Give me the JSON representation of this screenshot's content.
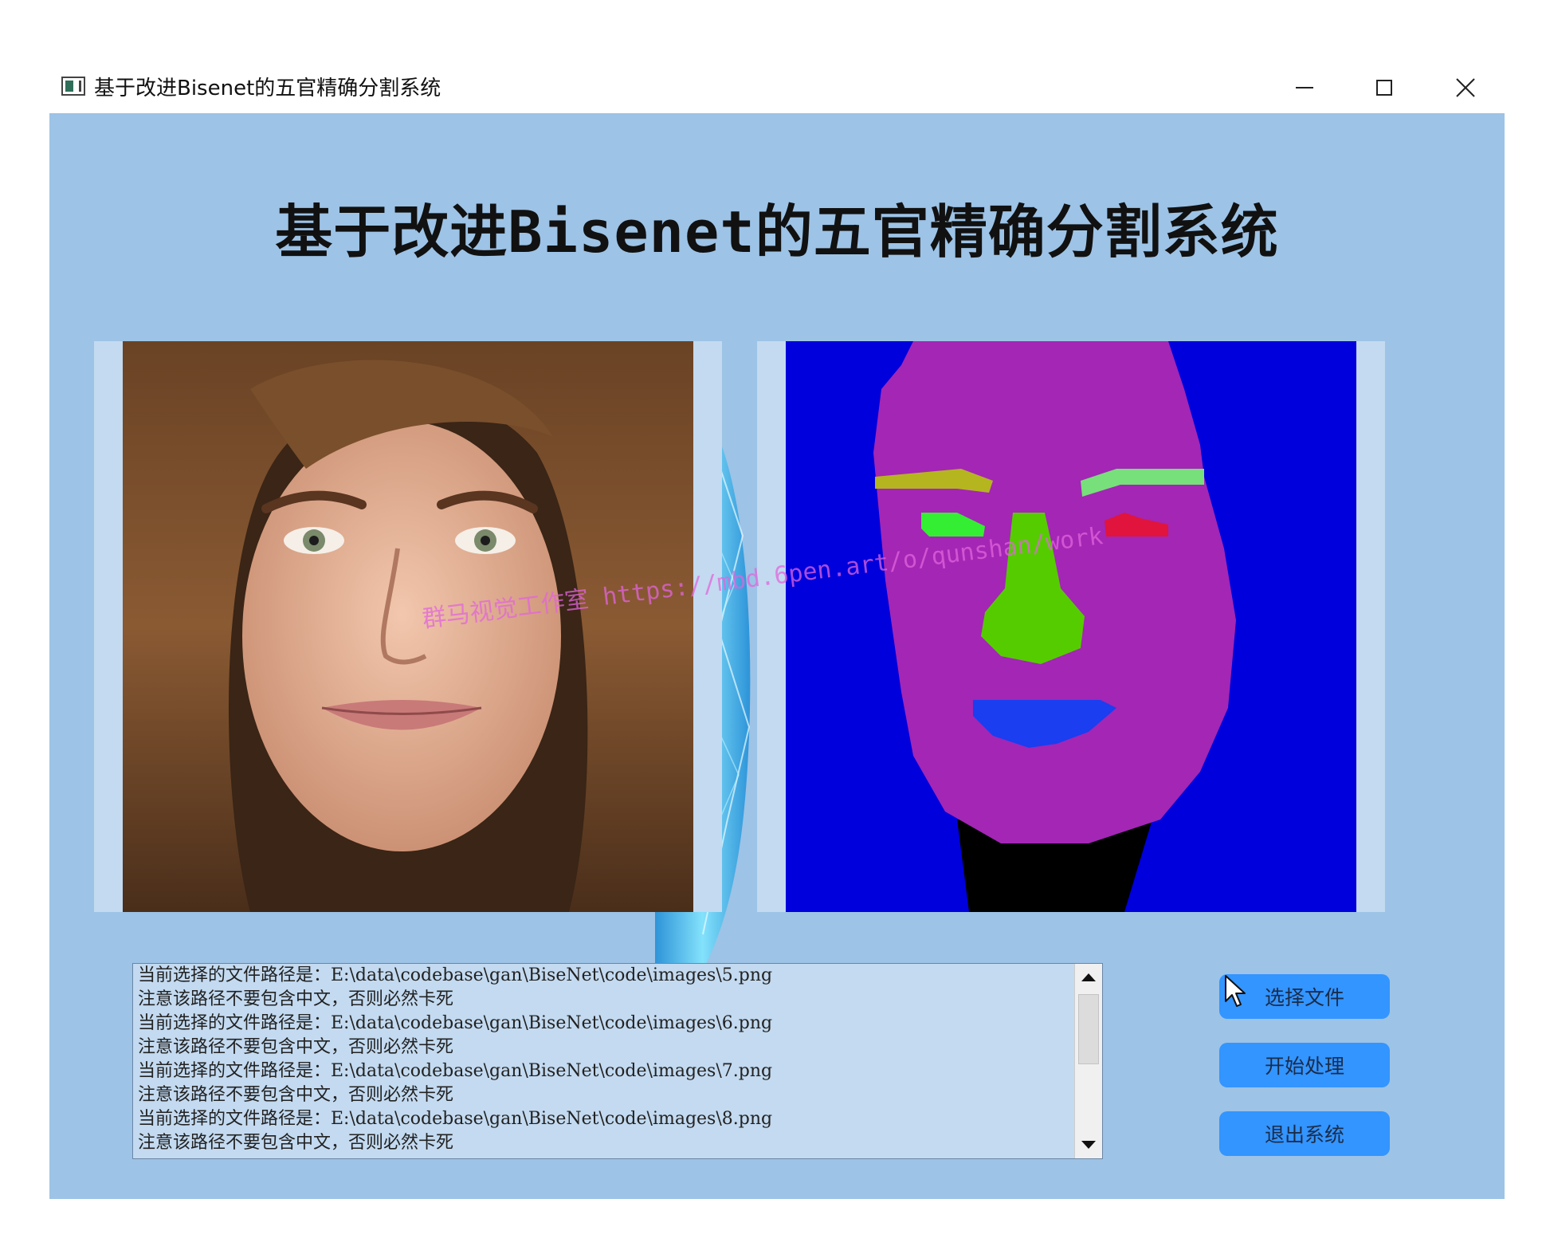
{
  "window": {
    "title": "基于改进Bisenet的五官精确分割系统",
    "controls": [
      "minimize",
      "maximize",
      "close"
    ]
  },
  "heading": "基于改进Bisenet的五官精确分割系统",
  "panels": {
    "left": {
      "content": "original face photo"
    },
    "right": {
      "content": "segmentation mask"
    }
  },
  "log": {
    "lines": [
      "当前选择的文件路径是：E:\\data\\codebase\\gan\\BiseNet\\code\\images\\5.png",
      "注意该路径不要包含中文，否则必然卡死",
      "当前选择的文件路径是：E:\\data\\codebase\\gan\\BiseNet\\code\\images\\6.png",
      "注意该路径不要包含中文，否则必然卡死",
      "当前选择的文件路径是：E:\\data\\codebase\\gan\\BiseNet\\code\\images\\7.png",
      "注意该路径不要包含中文，否则必然卡死",
      "当前选择的文件路径是：E:\\data\\codebase\\gan\\BiseNet\\code\\images\\8.png",
      "注意该路径不要包含中文，否则必然卡死"
    ]
  },
  "buttons": {
    "select_file": "选择文件",
    "start_process": "开始处理",
    "exit_system": "退出系统"
  },
  "watermark": "群马视觉工作室 https://mbd.6pen.art/o/qunshan/work",
  "colors": {
    "client_bg": "#9dc3e6",
    "panel_bg": "#c3daf0",
    "button_bg": "#3395ff",
    "mask_background": "#0000dd",
    "mask_skin": "#a326b5",
    "mask_nose": "#55cc00",
    "mask_lips": "#1a3ef0",
    "mask_brow_left": "#b5b520",
    "mask_brow_right": "#77e07a",
    "mask_eye_left": "#33ee33",
    "mask_eye_right": "#e0143c",
    "mask_neck": "#000000"
  },
  "icons": {
    "app": "app-window-icon",
    "minimize": "minimize-icon",
    "maximize": "maximize-icon",
    "close": "close-icon",
    "scroll_up": "arrow-up-icon",
    "scroll_down": "arrow-down-icon",
    "cursor": "mouse-pointer-icon"
  }
}
